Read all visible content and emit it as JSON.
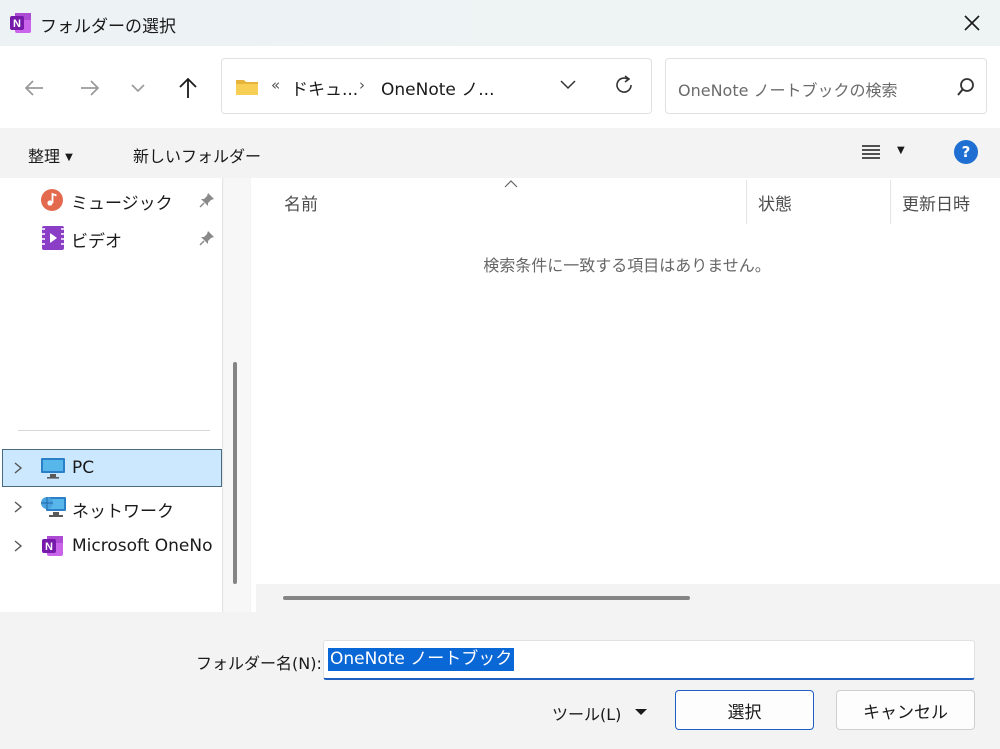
{
  "window": {
    "title": "フォルダーの選択",
    "app_icon": "onenote-icon"
  },
  "address_bar": {
    "overflow": "«",
    "crumbs": [
      "ドキュ...",
      "OneNote ノ..."
    ],
    "separator": "›"
  },
  "search": {
    "placeholder": "OneNote ノートブックの検索"
  },
  "command_bar": {
    "organize": "整理",
    "new_folder": "新しいフォルダー"
  },
  "nav_pane": {
    "quick_access": [
      {
        "label": "ミュージック",
        "icon": "music-icon",
        "pinned": true
      },
      {
        "label": "ビデオ",
        "icon": "video-icon",
        "pinned": true
      }
    ],
    "tree": [
      {
        "label": "PC",
        "icon": "pc-icon",
        "selected": true
      },
      {
        "label": "ネットワーク",
        "icon": "network-icon",
        "selected": false
      },
      {
        "label": "Microsoft OneNo",
        "icon": "onenote-icon",
        "selected": false
      }
    ]
  },
  "content": {
    "columns": [
      "名前",
      "状態",
      "更新日時"
    ],
    "empty_message": "検索条件に一致する項目はありません。"
  },
  "footer": {
    "folder_name_label": "フォルダー名(N):",
    "folder_name_value": "OneNote ノートブック",
    "tools": "ツール(L)",
    "select_button": "選択",
    "cancel_button": "キャンセル"
  },
  "colors": {
    "accent": "#1e5fbf",
    "selection": "#0a67d6",
    "help": "#1e6fd1",
    "onenote": "#7b2fa8"
  }
}
